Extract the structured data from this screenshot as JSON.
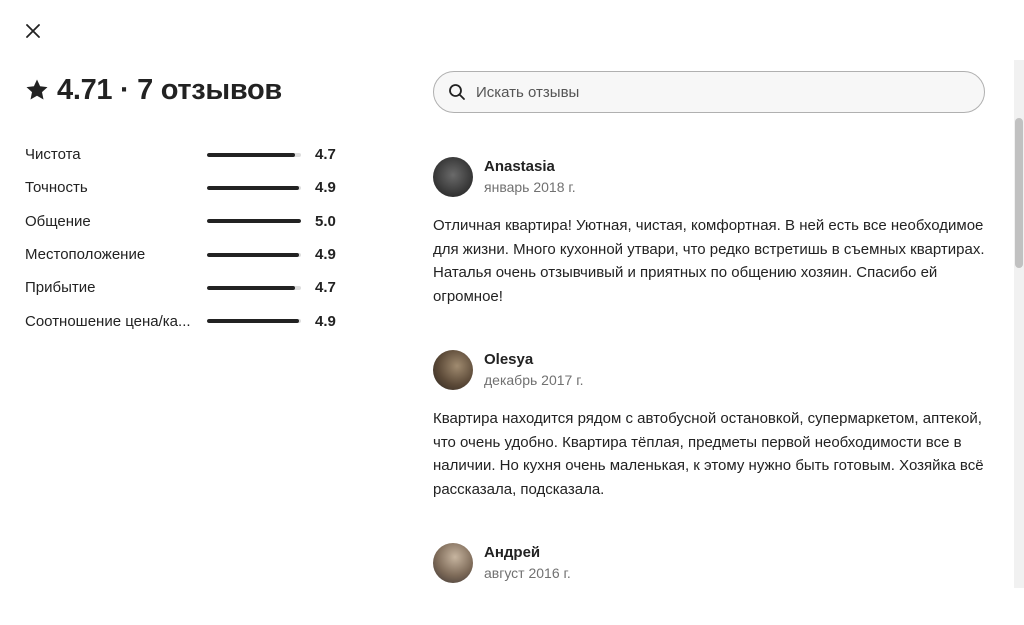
{
  "dialog": {
    "close_icon": "close-icon"
  },
  "summary": {
    "star_icon": "star-icon",
    "text": "4.71 · 7 отзывов"
  },
  "ratings": [
    {
      "label": "Чистота",
      "value": "4.7",
      "fill": 0.94
    },
    {
      "label": "Точность",
      "value": "4.9",
      "fill": 0.98
    },
    {
      "label": "Общение",
      "value": "5.0",
      "fill": 1.0
    },
    {
      "label": "Местоположение",
      "value": "4.9",
      "fill": 0.98
    },
    {
      "label": "Прибытие",
      "value": "4.7",
      "fill": 0.94
    },
    {
      "label": "Соотношение цена/ка...",
      "value": "4.9",
      "fill": 0.98
    }
  ],
  "search": {
    "placeholder": "Искать отзывы",
    "icon": "search-icon"
  },
  "reviews": [
    {
      "name": "Anastasia",
      "date": "январь 2018 г.",
      "text": "Отличная квартира! Уютная, чистая, комфортная. В ней есть все необходимое для жизни. Много кухонной утвари, что редко встретишь в съемных квартирах. Наталья очень отзывчивый и приятных по общению хозяин. Спасибо ей огромное!"
    },
    {
      "name": "Olesya",
      "date": "декабрь 2017 г.",
      "text": "Квартира находится рядом с автобусной остановкой, супермаркетом, аптекой, что очень удобно. Квартира тёплая, предметы первой необходимости все в наличии. Но кухня очень маленькая, к этому нужно быть готовым. Хозяйка всё рассказала, подсказала."
    },
    {
      "name": "Андрей",
      "date": "август 2016 г.",
      "text": ""
    }
  ],
  "colors": {
    "text": "#222222",
    "muted": "#717171",
    "bar_bg": "#dddddd",
    "bar_fill": "#222222"
  }
}
